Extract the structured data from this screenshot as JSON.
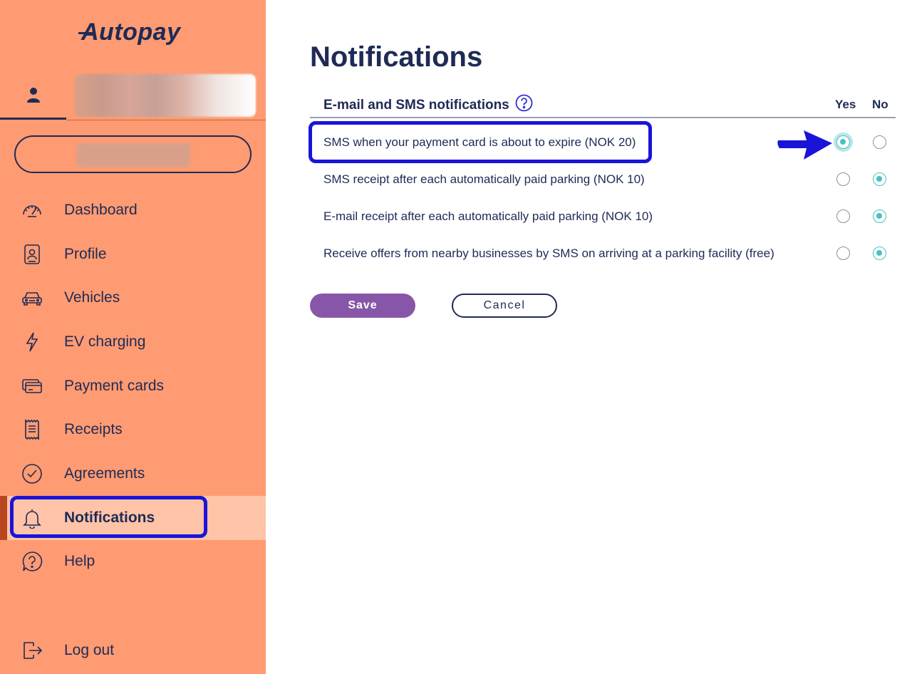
{
  "app": {
    "logo_text": "Autopay"
  },
  "sidebar": {
    "items": [
      {
        "label": "Dashboard",
        "icon": "speedometer-icon"
      },
      {
        "label": "Profile",
        "icon": "id-badge-icon"
      },
      {
        "label": "Vehicles",
        "icon": "car-icon"
      },
      {
        "label": "EV charging",
        "icon": "lightning-icon"
      },
      {
        "label": "Payment cards",
        "icon": "credit-cards-icon"
      },
      {
        "label": "Receipts",
        "icon": "receipt-icon"
      },
      {
        "label": "Agreements",
        "icon": "check-circle-icon"
      },
      {
        "label": "Notifications",
        "icon": "bell-icon",
        "active": true
      },
      {
        "label": "Help",
        "icon": "help-bubble-icon"
      }
    ],
    "logout_label": "Log out"
  },
  "main": {
    "title": "Notifications",
    "section_header": "E-mail and SMS notifications",
    "col_yes": "Yes",
    "col_no": "No",
    "rows": [
      {
        "label": "SMS when your payment card is about to expire (NOK 20)",
        "selected": "yes"
      },
      {
        "label": "SMS receipt after each automatically paid parking (NOK 10)",
        "selected": "no"
      },
      {
        "label": "E-mail receipt after each automatically paid parking (NOK 10)",
        "selected": "no"
      },
      {
        "label": "Receive offers from nearby businesses by SMS on arriving at a parking facility (free)",
        "selected": "no"
      }
    ],
    "save_label": "Save",
    "cancel_label": "Cancel"
  },
  "colors": {
    "sidebar_bg": "#ff9b72",
    "active_item_bg": "#ffc3a8",
    "navy": "#1f2a55",
    "radio_teal": "#46c1c4",
    "save_purple": "#8756a9",
    "annotation_blue": "#1a14d9"
  }
}
